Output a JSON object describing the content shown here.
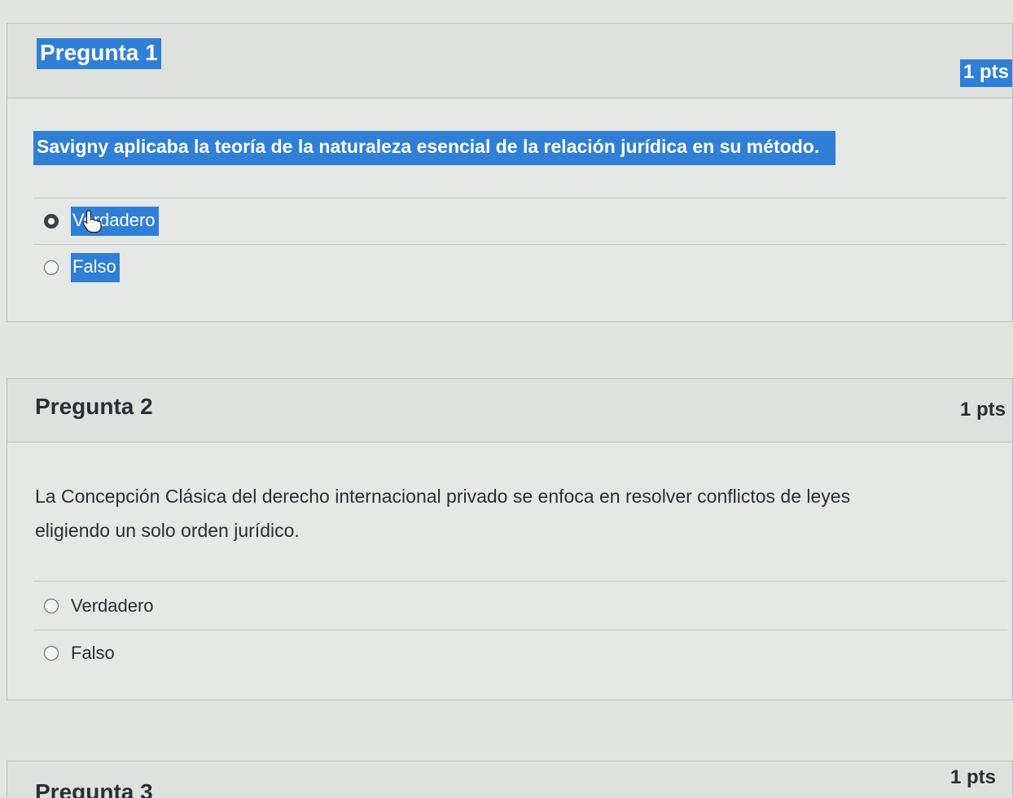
{
  "questions": [
    {
      "title": "Pregunta 1",
      "points": "1 pts",
      "text": "Savigny aplicaba la teoría de la naturaleza esencial de la relación jurídica en su método.",
      "answers": [
        {
          "label": "Verdadero",
          "selected": true
        },
        {
          "label": "Falso",
          "selected": false
        }
      ]
    },
    {
      "title": "Pregunta 2",
      "points": "1 pts",
      "text_line1": "La Concepción Clásica del derecho internacional privado se enfoca en resolver conflictos de leyes",
      "text_line2": "eligiendo un solo orden jurídico.",
      "answers": [
        {
          "label": "Verdadero",
          "selected": false
        },
        {
          "label": "Falso",
          "selected": false
        }
      ]
    },
    {
      "title": "Pregunta 3",
      "points": "1 pts"
    }
  ],
  "colors": {
    "highlight": "#2f7fd6",
    "background": "#e3e5e3"
  },
  "icons": {
    "cursor": "hand-pointer-icon"
  }
}
